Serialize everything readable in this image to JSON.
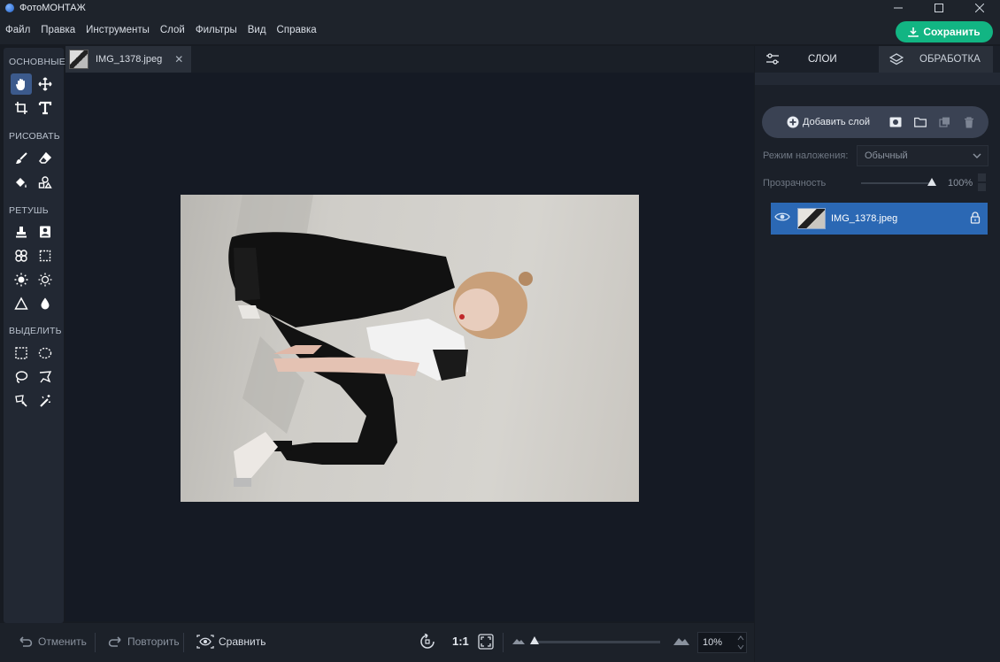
{
  "window": {
    "title": "ФотоМОНТАЖ"
  },
  "menu": {
    "items": [
      "Файл",
      "Правка",
      "Инструменты",
      "Слой",
      "Фильтры",
      "Вид",
      "Справка"
    ]
  },
  "save_button": {
    "label": "Сохранить"
  },
  "toolbox": {
    "sections": {
      "basic": "ОСНОВНЫЕ",
      "draw": "РИСОВАТЬ",
      "retouch": "РЕТУШЬ",
      "select": "ВЫДЕЛИТЬ"
    },
    "tools": [
      "hand-tool",
      "move-tool",
      "crop-tool",
      "text-tool",
      "brush-tool",
      "eraser-tool",
      "fill-tool",
      "shapes-tool",
      "stamp-tool",
      "healing-tool",
      "patch-tool",
      "frame-tool",
      "brighten-tool",
      "darken-tool",
      "sharpen-tool",
      "blur-tool",
      "rect-select-tool",
      "ellipse-select-tool",
      "lasso-tool",
      "poly-lasso-tool",
      "magnetic-lasso-tool",
      "magic-wand-tool"
    ]
  },
  "document": {
    "tab_name": "IMG_1378.jpeg"
  },
  "bottom_bar": {
    "undo": "Отменить",
    "redo": "Повторить",
    "compare": "Сравнить",
    "actual_size": "1:1",
    "zoom_value": "10%",
    "zoom_fraction": 0.0
  },
  "right_panel": {
    "tabs": {
      "layers": "СЛОИ",
      "processing": "ОБРАБОТКА"
    },
    "add_layer": "Добавить слой",
    "blend_label": "Режим наложения:",
    "blend_value": "Обычный",
    "opacity_label": "Прозрачность",
    "opacity_value": "100%",
    "layers": [
      {
        "name": "IMG_1378.jpeg"
      }
    ]
  },
  "colors": {
    "accent": "#12b583",
    "selection": "#2b68b4",
    "active_tool": "#3c5a8c"
  }
}
